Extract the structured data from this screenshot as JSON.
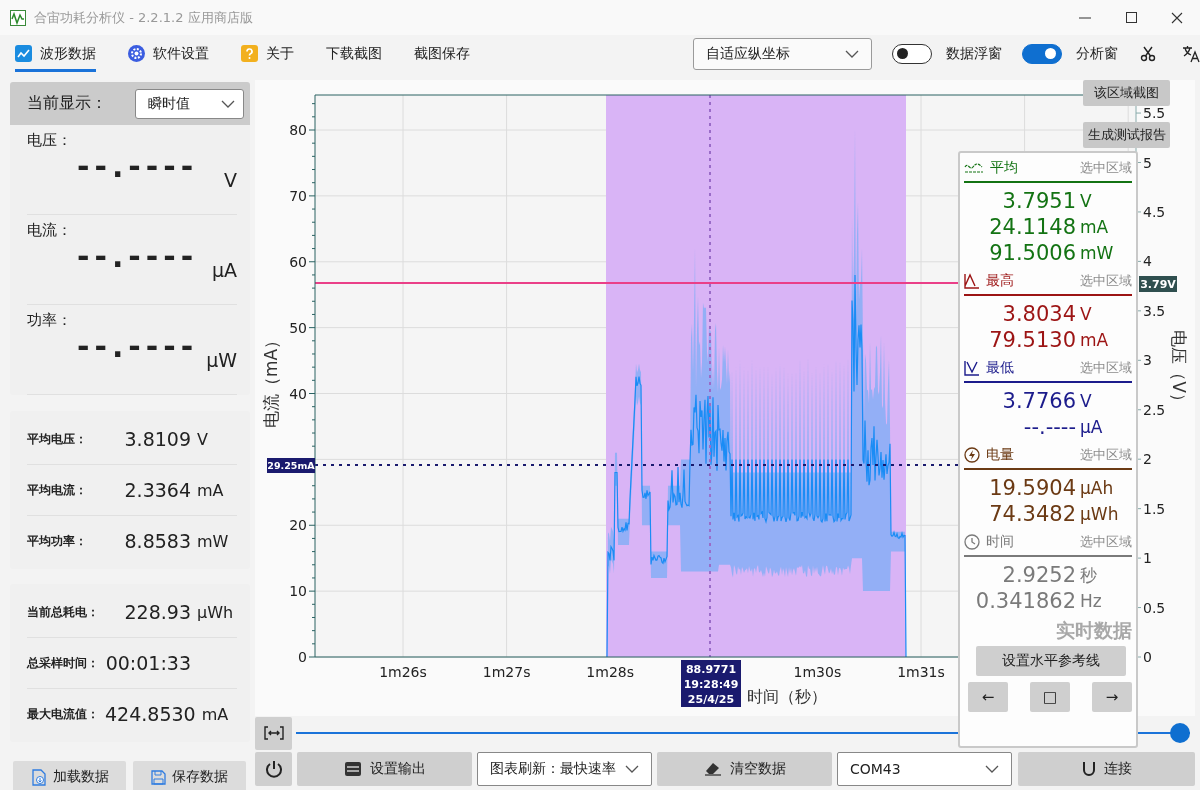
{
  "window": {
    "title": "合宙功耗分析仪 - 2.2.1.2 应用商店版"
  },
  "tabs": [
    {
      "label": "波形数据",
      "kind": "wave",
      "selected": true
    },
    {
      "label": "软件设置",
      "kind": "gear",
      "selected": false
    },
    {
      "label": "关于",
      "kind": "help",
      "selected": false
    },
    {
      "label": "下载截图",
      "kind": "plain",
      "selected": false
    },
    {
      "label": "截图保存",
      "kind": "plain",
      "selected": false
    }
  ],
  "axis_mode": {
    "value": "自适应纵坐标"
  },
  "toggles": [
    {
      "label": "数据浮窗",
      "on": false
    },
    {
      "label": "分析窗",
      "on": true
    }
  ],
  "current_display": {
    "label": "当前显示：",
    "value": "瞬时值",
    "readings": [
      {
        "label": "电压：",
        "value": "--.----",
        "unit": "V"
      },
      {
        "label": "电流：",
        "value": "--.----",
        "unit": "μA"
      },
      {
        "label": "功率：",
        "value": "--.----",
        "unit": "μW"
      }
    ]
  },
  "averages": [
    {
      "label": "平均电压：",
      "value": "3.8109",
      "unit": "V"
    },
    {
      "label": "平均电流：",
      "value": "2.3364",
      "unit": "mA"
    },
    {
      "label": "平均功率：",
      "value": "8.8583",
      "unit": "mW"
    }
  ],
  "totals": [
    {
      "label": "当前总耗电：",
      "value": "228.93",
      "unit": "μWh"
    },
    {
      "label": "总采样时间：",
      "value": "00:01:33"
    },
    {
      "label": "最大电流值：",
      "value": "424.8530",
      "unit": "mA"
    }
  ],
  "file_buttons": [
    {
      "label": "加载数据",
      "kind": "load"
    },
    {
      "label": "保存数据",
      "kind": "save"
    }
  ],
  "chart": {
    "y_title": "电流（mA）",
    "y_ticks_upper": [
      "80",
      "70",
      "60",
      "50",
      "40"
    ],
    "y_ticks_lower": [
      "20",
      "10",
      "0"
    ],
    "x_ticks_left": [
      "1m26s",
      "1m27s",
      "1m28s"
    ],
    "x_ticks_right": [
      "1m30s",
      "1m31s"
    ],
    "x_title": "时间（秒）",
    "y2_title": "电压（V）",
    "y2_ticks": [
      "5.5",
      "5",
      "4.5",
      "4",
      "3.5",
      "3",
      "2.5",
      "2",
      "1.5",
      "1",
      "0.5",
      "0"
    ],
    "reference_label": "29.25mA",
    "voltage_label": "3.79V",
    "cursor_label": [
      "88.9771",
      "19:28:49",
      "25/4/25"
    ]
  },
  "region_buttons": [
    "该区域截图",
    "生成测试报告"
  ],
  "analysis": {
    "sections": [
      {
        "kind": "avg",
        "title": "平均",
        "scope": "选中区域",
        "color": "#137313",
        "values": [
          {
            "value": "3.7951",
            "unit": "V"
          },
          {
            "value": "24.1148",
            "unit": "mA"
          },
          {
            "value": "91.5006",
            "unit": "mW"
          }
        ]
      },
      {
        "kind": "max",
        "title": "最高",
        "scope": "选中区域",
        "color": "#9c1414",
        "values": [
          {
            "value": "3.8034",
            "unit": "V"
          },
          {
            "value": "79.5130",
            "unit": "mA"
          }
        ]
      },
      {
        "kind": "min",
        "title": "最低",
        "scope": "选中区域",
        "color": "#1c1c8c",
        "values": [
          {
            "value": "3.7766",
            "unit": "V"
          },
          {
            "value": "--.----",
            "unit": "μA"
          }
        ]
      },
      {
        "kind": "energy",
        "title": "电量",
        "scope": "选中区域",
        "color": "#6b3a14",
        "values": [
          {
            "value": "19.5904",
            "unit": "μAh"
          },
          {
            "value": "74.3482",
            "unit": "μWh"
          }
        ]
      },
      {
        "kind": "time",
        "title": "时间",
        "scope": "选中区域",
        "color": "#7a7a7a",
        "values": [
          {
            "value": "2.9252",
            "unit": "秒"
          },
          {
            "value": "0.341862",
            "unit": "Hz"
          }
        ]
      }
    ],
    "mode_label": "实时数据",
    "reference_button": "设置水平参考线",
    "nav_buttons": [
      "←",
      "□",
      "→"
    ]
  },
  "zoom_slider": {
    "level": 1
  },
  "bottom": {
    "output_button": "设置输出",
    "refresh": {
      "value": "图表刷新：最快速率"
    },
    "clear_button": "清空数据",
    "port": {
      "value": "COM43"
    },
    "connect_button": "连接"
  }
}
